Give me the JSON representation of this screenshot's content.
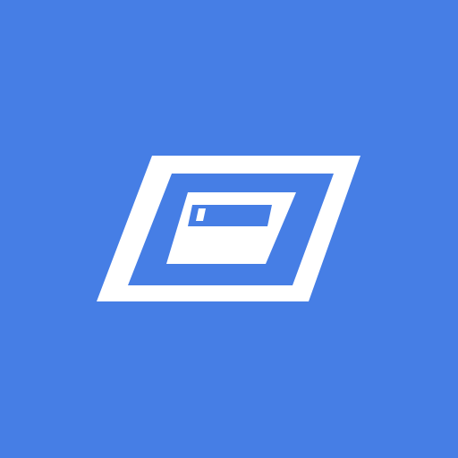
{
  "app_icon": {
    "icon_name": "slanted-window-frame-icon",
    "colors": {
      "background": "#467EE5",
      "foreground": "#FFFFFF"
    }
  }
}
